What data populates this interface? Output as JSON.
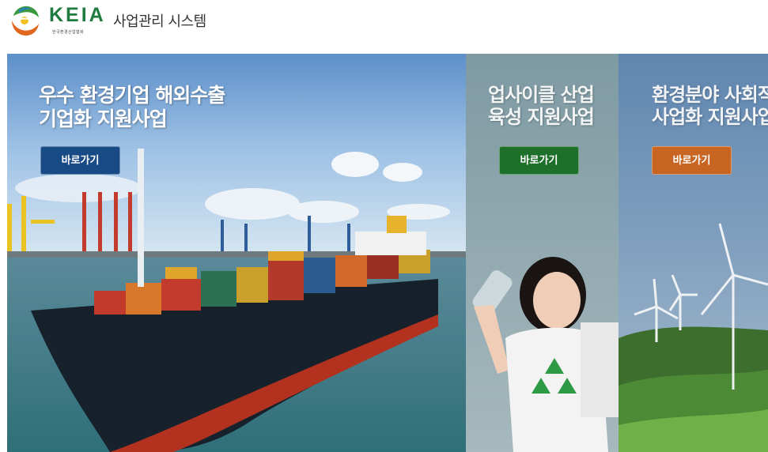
{
  "header": {
    "brand": "KEIA",
    "brand_sub": "한국환경산업협회",
    "system_title": "사업관리 시스템"
  },
  "colors": {
    "brand_green": "#1f7b3f",
    "btn_blue": "#184a86",
    "btn_green": "#1e6f2a",
    "btn_orange": "#c96522"
  },
  "banners": [
    {
      "title_line1": "우수 환경기업 해외수출",
      "title_line2": "기업화 지원사업",
      "button_label": "바로가기",
      "image": "container-ship"
    },
    {
      "title_line1": "업사이클 산업",
      "title_line2": "육성 지원사업",
      "button_label": "바로가기",
      "image": "girl-recycling-shirt"
    },
    {
      "title_line1": "환경분야 사회적",
      "title_line2": "사업화 지원사업",
      "button_label": "바로가기",
      "image": "wind-turbines"
    }
  ]
}
